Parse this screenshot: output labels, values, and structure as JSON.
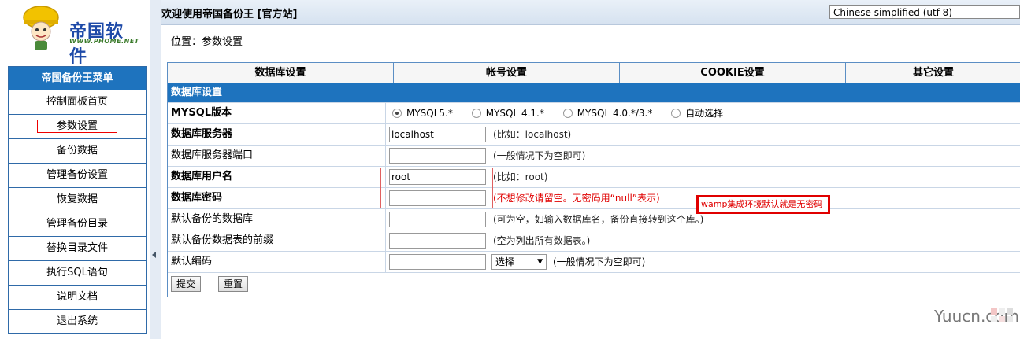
{
  "logo": {
    "brand": "帝国软件",
    "url_text": "WWW.PHOME.NET",
    "icon": "mascot-logo"
  },
  "menu": {
    "title": "帝国备份王菜单",
    "items": [
      {
        "label": "控制面板首页"
      },
      {
        "label": "参数设置"
      },
      {
        "label": "备份数据"
      },
      {
        "label": "管理备份设置"
      },
      {
        "label": "恢复数据"
      },
      {
        "label": "管理备份目录"
      },
      {
        "label": "替换目录文件"
      },
      {
        "label": "执行SQL语句"
      },
      {
        "label": "说明文档"
      },
      {
        "label": "退出系统"
      }
    ]
  },
  "header": {
    "welcome": "欢迎使用帝国备份王 [官方站]",
    "language": "Chinese simplified (utf-8)"
  },
  "location": "位置：参数设置",
  "tabs": [
    "数据库设置",
    "帐号设置",
    "COOKIE设置",
    "其它设置"
  ],
  "section_title": "数据库设置",
  "form": {
    "mysql_version": {
      "label": "MYSQL版本",
      "options": [
        "MYSQL5.*",
        "MYSQL 4.1.*",
        "MYSQL 4.0.*/3.*",
        "自动选择"
      ],
      "selected": "MYSQL5.*"
    },
    "db_server": {
      "label": "数据库服务器",
      "value": "localhost",
      "hint": "(比如：localhost)"
    },
    "db_port": {
      "label": "数据库服务器端口",
      "value": "",
      "hint": "(一般情况下为空即可)"
    },
    "db_user": {
      "label": "数据库用户名",
      "value": "root",
      "hint": "(比如：root)"
    },
    "db_password": {
      "label": "数据库密码",
      "value": "",
      "hint": "(不想修改请留空。无密码用“null”表示)"
    },
    "default_db": {
      "label": "默认备份的数据库",
      "value": "",
      "hint": "(可为空，如输入数据库名，备份直接转到这个库。)"
    },
    "table_prefix": {
      "label": "默认备份数据表的前缀",
      "value": "",
      "hint": "(空为列出所有数据表。)"
    },
    "default_charset": {
      "label": "默认编码",
      "value": "",
      "select_value": "选择",
      "hint": "(一般情况下为空即可)"
    }
  },
  "buttons": {
    "submit": "提交",
    "reset": "重置"
  },
  "annotation_note": "wamp集成环境默认就是无密码",
  "watermark": "Yuucn.com"
}
